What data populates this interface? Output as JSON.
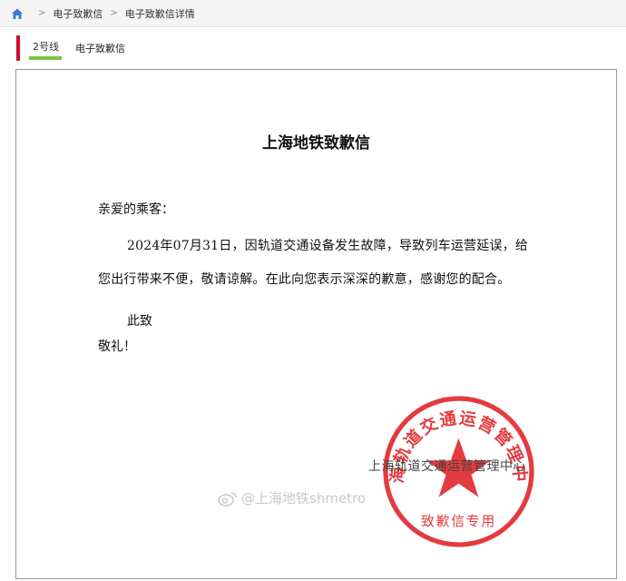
{
  "breadcrumb": {
    "home_icon": "home-icon",
    "separator": ">",
    "items": [
      "电子致歉信",
      "电子致歉信详情"
    ]
  },
  "line_header": {
    "badge": "2号线",
    "title": "电子致歉信",
    "accent_color": "#c8102e",
    "line_color": "#7cc242"
  },
  "letter": {
    "title": "上海地铁致歉信",
    "salutation": "亲爱的乘客：",
    "paragraph_line1": "2024年07月31日，因轨道交通设备发生故障，导致列车运营延误，给",
    "paragraph_line2": "您出行带来不便，敬请谅解。在此向您表示深深的歉意，感谢您的配合。",
    "closing_1": "此致",
    "closing_2": "敬礼！",
    "signature": "上海轨道交通运营管理中心",
    "seal_text": "上海轨道交通运营管理中心",
    "seal_bottom_text": "致歉信专用",
    "seal_color": "#e0262b"
  },
  "watermark": {
    "text": "@上海地铁shmetro",
    "icon": "weibo-icon"
  }
}
